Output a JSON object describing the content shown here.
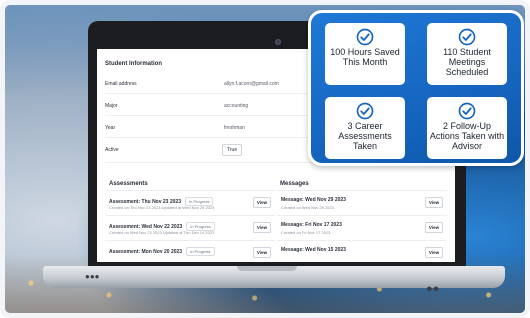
{
  "student_info": {
    "title": "Student Information",
    "fields": [
      {
        "label": "Email address",
        "value": "allyn.f.acorn@gmail.com"
      },
      {
        "label": "Major",
        "value": "accounting"
      },
      {
        "label": "Year",
        "value": "freshman"
      },
      {
        "label": "Active",
        "value": "True"
      }
    ]
  },
  "assessments": {
    "title": "Assessments",
    "items": [
      {
        "title": "Assessment: Thu Nov 23 2023",
        "status": "In Progress",
        "sub": "Created on Thu Nov 23 2023   Updated at Wed Nov 29 2023",
        "button": "View"
      },
      {
        "title": "Assessment: Wed Nov 22 2023",
        "status": "In Progress",
        "sub": "Created on Wed Nov 22 2023   Updated at Thu Dec 14 2023",
        "button": "View"
      },
      {
        "title": "Assessment: Mon Nov 20 2023",
        "status": "In Progress",
        "sub": "",
        "button": "View"
      }
    ]
  },
  "messages": {
    "title": "Messages",
    "items": [
      {
        "title": "Message: Wed Nov 29 2023",
        "sub": "Created on Wed Nov 29 2023",
        "button": "View"
      },
      {
        "title": "Message: Fri Nov 17 2023",
        "sub": "Created on Fri Nov 17 2023",
        "button": "View"
      },
      {
        "title": "Message: Wed Nov 15 2023",
        "sub": "",
        "button": "View"
      }
    ]
  },
  "stats": [
    {
      "text": "100 Hours Saved This Month",
      "icon": "check-circle-icon"
    },
    {
      "text": "110 Student Meetings Scheduled",
      "icon": "check-circle-icon"
    },
    {
      "text": "3 Career Assessments Taken",
      "icon": "check-circle-icon"
    },
    {
      "text": "2 Follow-Up Actions Taken with Advisor",
      "icon": "check-circle-icon"
    }
  ],
  "colors": {
    "stats_panel": "#1565c0",
    "check": "#1565c0"
  }
}
